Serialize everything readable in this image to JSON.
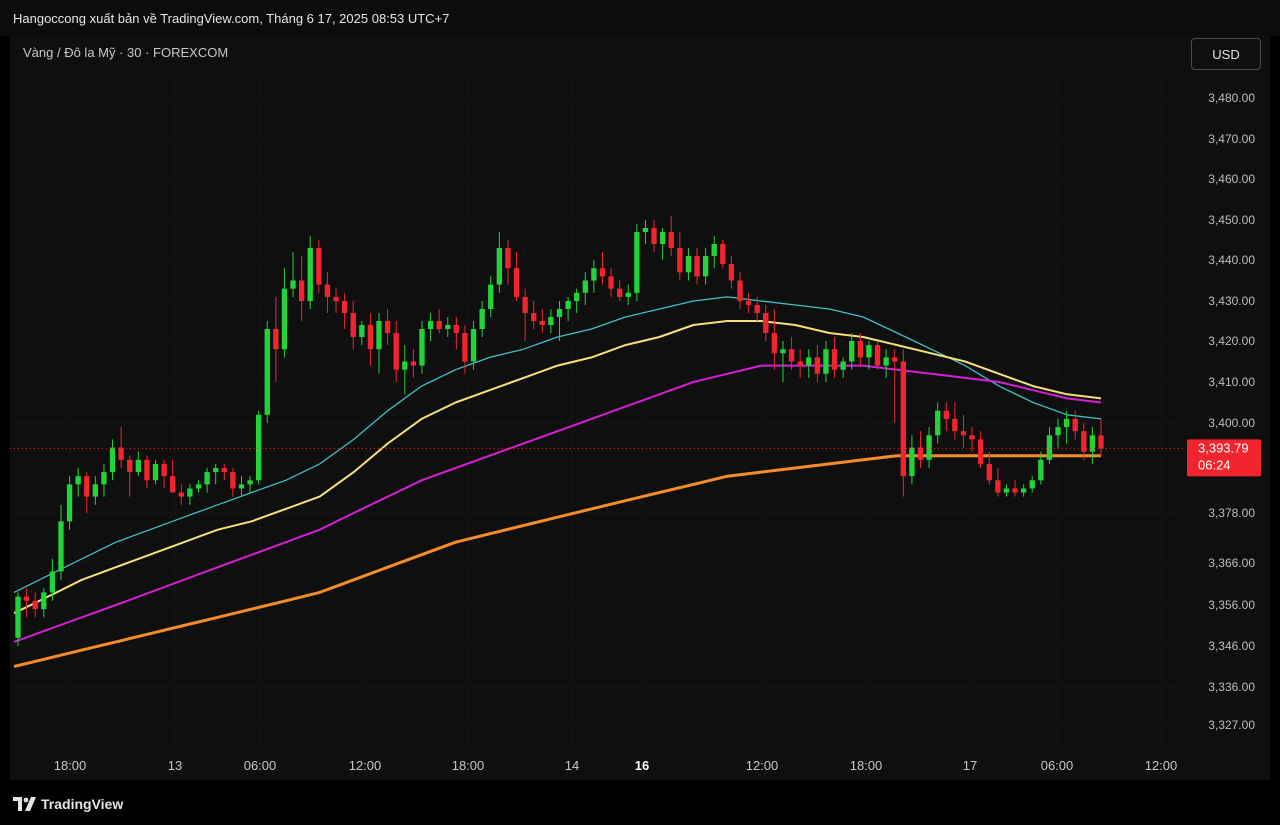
{
  "header": {
    "title": "Hangoccong xuất bản về TradingView.com, Tháng 6 17, 2025 08:53 UTC+7"
  },
  "symbol": {
    "label": "Vàng / Đô la Mỹ · 30 · FOREXCOM"
  },
  "currency_button": "USD",
  "footer": {
    "logo_text": "TradingView"
  },
  "chart_data": {
    "type": "candlestick",
    "title": "Vàng / Đô la Mỹ · 30 · FOREXCOM",
    "y_ticks": [
      3327,
      3336,
      3346,
      3356,
      3366,
      3378,
      3400,
      3410,
      3420,
      3430,
      3440,
      3450,
      3460,
      3470,
      3480
    ],
    "y_tick_labels": [
      "3,327.00",
      "3,336.00",
      "3,346.00",
      "3,356.00",
      "3,366.00",
      "3,378.00",
      "3,400.00",
      "3,410.00",
      "3,420.00",
      "3,430.00",
      "3,440.00",
      "3,450.00",
      "3,460.00",
      "3,470.00",
      "3,480.00"
    ],
    "x_tick_labels": [
      "18:00",
      "13",
      "06:00",
      "12:00",
      "18:00",
      "14",
      "16",
      "12:00",
      "18:00",
      "17",
      "06:00",
      "12:00"
    ],
    "x_tick_bold": [
      "16"
    ],
    "last_price": {
      "value": 3393.79,
      "label": "3,393.79",
      "countdown": "06:24"
    },
    "colors": {
      "up": "#22d33a",
      "down": "#f2252e",
      "ema_cyan": "#3fc2c6",
      "ema_yellow": "#f5e17b",
      "ema_magenta": "#d51fd6",
      "ema_orange": "#f58b2a",
      "price_line": "#e8322a"
    },
    "candles": [
      [
        3348,
        3359,
        3346,
        3358
      ],
      [
        3358,
        3360,
        3353,
        3357
      ],
      [
        3357,
        3359,
        3353,
        3355
      ],
      [
        3355,
        3360,
        3353,
        3359
      ],
      [
        3359,
        3367,
        3357,
        3364
      ],
      [
        3364,
        3380,
        3362,
        3376
      ],
      [
        3376,
        3387,
        3374,
        3385
      ],
      [
        3385,
        3389,
        3382,
        3387
      ],
      [
        3387,
        3388,
        3378,
        3382
      ],
      [
        3382,
        3387,
        3380,
        3385
      ],
      [
        3385,
        3390,
        3382,
        3388
      ],
      [
        3388,
        3396,
        3386,
        3394
      ],
      [
        3394,
        3399,
        3389,
        3391
      ],
      [
        3391,
        3392,
        3382,
        3388
      ],
      [
        3388,
        3393,
        3387,
        3391
      ],
      [
        3391,
        3392,
        3384,
        3386
      ],
      [
        3386,
        3391,
        3385,
        3390
      ],
      [
        3390,
        3391,
        3384,
        3387
      ],
      [
        3387,
        3391,
        3384,
        3383
      ],
      [
        3383,
        3385,
        3380,
        3382
      ],
      [
        3382,
        3385,
        3380,
        3384
      ],
      [
        3384,
        3386,
        3383,
        3385
      ],
      [
        3385,
        3389,
        3383,
        3388
      ],
      [
        3388,
        3390,
        3385,
        3389
      ],
      [
        3389,
        3390,
        3386,
        3388
      ],
      [
        3388,
        3389,
        3382,
        3384
      ],
      [
        3384,
        3387,
        3382,
        3385
      ],
      [
        3385,
        3387,
        3383,
        3386
      ],
      [
        3386,
        3403,
        3385,
        3402
      ],
      [
        3402,
        3425,
        3400,
        3423
      ],
      [
        3423,
        3431,
        3410,
        3418
      ],
      [
        3418,
        3438,
        3416,
        3433
      ],
      [
        3433,
        3442,
        3431,
        3435
      ],
      [
        3435,
        3441,
        3425,
        3430
      ],
      [
        3430,
        3446,
        3428,
        3443
      ],
      [
        3443,
        3445,
        3432,
        3434
      ],
      [
        3434,
        3437,
        3427,
        3431
      ],
      [
        3431,
        3433,
        3427,
        3430
      ],
      [
        3430,
        3432,
        3423,
        3427
      ],
      [
        3427,
        3430,
        3418,
        3421
      ],
      [
        3421,
        3425,
        3419,
        3424
      ],
      [
        3424,
        3427,
        3414,
        3418
      ],
      [
        3418,
        3427,
        3412,
        3425
      ],
      [
        3425,
        3428,
        3419,
        3422
      ],
      [
        3422,
        3425,
        3410,
        3413
      ],
      [
        3413,
        3419,
        3407,
        3415
      ],
      [
        3415,
        3418,
        3411,
        3414
      ],
      [
        3414,
        3425,
        3412,
        3423
      ],
      [
        3423,
        3427,
        3420,
        3425
      ],
      [
        3425,
        3428,
        3422,
        3423
      ],
      [
        3423,
        3426,
        3421,
        3424
      ],
      [
        3424,
        3426,
        3418,
        3422
      ],
      [
        3422,
        3424,
        3412,
        3415
      ],
      [
        3415,
        3425,
        3413,
        3423
      ],
      [
        3423,
        3430,
        3421,
        3428
      ],
      [
        3428,
        3436,
        3426,
        3434
      ],
      [
        3434,
        3447,
        3432,
        3443
      ],
      [
        3443,
        3445,
        3434,
        3438
      ],
      [
        3438,
        3442,
        3430,
        3431
      ],
      [
        3431,
        3433,
        3420,
        3427
      ],
      [
        3427,
        3430,
        3423,
        3425
      ],
      [
        3425,
        3428,
        3422,
        3424
      ],
      [
        3424,
        3428,
        3422,
        3426
      ],
      [
        3426,
        3430,
        3420,
        3428
      ],
      [
        3428,
        3431,
        3425,
        3430
      ],
      [
        3430,
        3433,
        3427,
        3432
      ],
      [
        3432,
        3437,
        3429,
        3435
      ],
      [
        3435,
        3440,
        3432,
        3438
      ],
      [
        3438,
        3442,
        3434,
        3436
      ],
      [
        3436,
        3438,
        3431,
        3433
      ],
      [
        3433,
        3435,
        3430,
        3431
      ],
      [
        3431,
        3434,
        3429,
        3432
      ],
      [
        3432,
        3449,
        3430,
        3447
      ],
      [
        3447,
        3450,
        3444,
        3448
      ],
      [
        3448,
        3450,
        3442,
        3444
      ],
      [
        3444,
        3448,
        3440,
        3447
      ],
      [
        3447,
        3451,
        3441,
        3443
      ],
      [
        3443,
        3447,
        3435,
        3437
      ],
      [
        3437,
        3443,
        3435,
        3441
      ],
      [
        3441,
        3443,
        3434,
        3436
      ],
      [
        3436,
        3443,
        3434,
        3441
      ],
      [
        3441,
        3446,
        3438,
        3444
      ],
      [
        3444,
        3445,
        3438,
        3439
      ],
      [
        3439,
        3441,
        3433,
        3435
      ],
      [
        3435,
        3437,
        3428,
        3430
      ],
      [
        3430,
        3432,
        3427,
        3429
      ],
      [
        3429,
        3431,
        3425,
        3427
      ],
      [
        3427,
        3429,
        3420,
        3422
      ],
      [
        3422,
        3428,
        3413,
        3417
      ],
      [
        3417,
        3420,
        3410,
        3418
      ],
      [
        3418,
        3421,
        3413,
        3415
      ],
      [
        3415,
        3418,
        3411,
        3414
      ],
      [
        3414,
        3418,
        3411,
        3416
      ],
      [
        3416,
        3419,
        3410,
        3412
      ],
      [
        3412,
        3420,
        3410,
        3418
      ],
      [
        3418,
        3421,
        3411,
        3413
      ],
      [
        3413,
        3416,
        3411,
        3415
      ],
      [
        3415,
        3422,
        3413,
        3420
      ],
      [
        3420,
        3422,
        3414,
        3416
      ],
      [
        3416,
        3420,
        3413,
        3419
      ],
      [
        3419,
        3420,
        3413,
        3414
      ],
      [
        3414,
        3418,
        3411,
        3416
      ],
      [
        3416,
        3418,
        3400,
        3415
      ],
      [
        3415,
        3418,
        3382,
        3387
      ],
      [
        3387,
        3397,
        3385,
        3394
      ],
      [
        3394,
        3398,
        3389,
        3391
      ],
      [
        3391,
        3399,
        3389,
        3397
      ],
      [
        3397,
        3405,
        3395,
        3403
      ],
      [
        3403,
        3405,
        3398,
        3401
      ],
      [
        3401,
        3405,
        3396,
        3398
      ],
      [
        3398,
        3402,
        3394,
        3397
      ],
      [
        3397,
        3399,
        3393,
        3396
      ],
      [
        3396,
        3398,
        3389,
        3390
      ],
      [
        3390,
        3393,
        3385,
        3386
      ],
      [
        3386,
        3389,
        3382,
        3383
      ],
      [
        3383,
        3385,
        3382,
        3384
      ],
      [
        3384,
        3386,
        3382,
        3383
      ],
      [
        3383,
        3385,
        3382,
        3384
      ],
      [
        3384,
        3387,
        3383,
        3386
      ],
      [
        3386,
        3393,
        3385,
        3391
      ],
      [
        3391,
        3399,
        3390,
        3397
      ],
      [
        3397,
        3401,
        3394,
        3399
      ],
      [
        3399,
        3403,
        3395,
        3401
      ],
      [
        3401,
        3403,
        3396,
        3398
      ],
      [
        3398,
        3400,
        3391,
        3393
      ],
      [
        3393,
        3399,
        3390,
        3397
      ],
      [
        3397,
        3401,
        3392,
        3393.79
      ]
    ],
    "ema_series": [
      {
        "color": "#3fc2c6",
        "values": [
          3359,
          3363,
          3367,
          3371,
          3374,
          3377,
          3380,
          3383,
          3386,
          3390,
          3396,
          3403,
          3409,
          3413,
          3416,
          3418,
          3421,
          3423,
          3426,
          3428,
          3430,
          3431,
          3430,
          3429,
          3428,
          3426,
          3422,
          3418,
          3414,
          3409,
          3405,
          3402,
          3401
        ]
      },
      {
        "color": "#f5e17b",
        "values": [
          3354,
          3358,
          3362,
          3365,
          3368,
          3371,
          3374,
          3376,
          3379,
          3382,
          3388,
          3395,
          3401,
          3405,
          3408,
          3411,
          3414,
          3416,
          3419,
          3421,
          3424,
          3425,
          3425,
          3424,
          3422,
          3421,
          3419,
          3417,
          3415,
          3412,
          3409,
          3407,
          3406
        ]
      },
      {
        "color": "#d51fd6",
        "values": [
          3347,
          3350,
          3353,
          3356,
          3359,
          3362,
          3365,
          3368,
          3371,
          3374,
          3378,
          3382,
          3386,
          3389,
          3392,
          3395,
          3398,
          3401,
          3404,
          3407,
          3410,
          3412,
          3414,
          3414,
          3414,
          3414,
          3413,
          3412,
          3411,
          3410,
          3408,
          3406,
          3405
        ]
      },
      {
        "color": "#f58b2a",
        "values": [
          3341,
          3343,
          3345,
          3347,
          3349,
          3351,
          3353,
          3355,
          3357,
          3359,
          3362,
          3365,
          3368,
          3371,
          3373,
          3375,
          3377,
          3379,
          3381,
          3383,
          3385,
          3387,
          3388,
          3389,
          3390,
          3391,
          3392,
          3392,
          3392,
          3392,
          3392,
          3392,
          3392
        ]
      }
    ]
  }
}
